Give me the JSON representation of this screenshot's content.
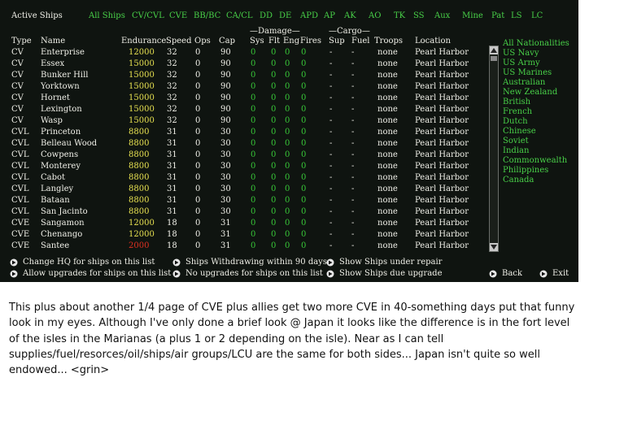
{
  "title": "Active Ships",
  "tabs": [
    "All Ships",
    "CV/CVL",
    "CVE",
    "BB/BC",
    "CA/CL",
    "DD",
    "DE",
    "APD",
    "AP",
    "AK",
    "AO",
    "TK",
    "SS",
    "Aux",
    "Mine",
    "Pat",
    "LS",
    "LC"
  ],
  "group_headers": {
    "damage": "Damage",
    "cargo": "Cargo"
  },
  "columns": [
    "Type",
    "Name",
    "Endurance",
    "Speed",
    "Ops",
    "Cap",
    "Sys",
    "Flt",
    "Eng",
    "Fires",
    "Sup",
    "Fuel",
    "Troops",
    "Location"
  ],
  "rows": [
    {
      "type": "CV",
      "name": "Enterprise",
      "endurance": "12000",
      "end_color": "yellow",
      "speed": "32",
      "ops": "0",
      "cap": "90",
      "sys": "0",
      "flt": "0",
      "eng": "0",
      "fires": "0",
      "sup": "-",
      "fuel": "-",
      "troops": "none",
      "location": "Pearl Harbor"
    },
    {
      "type": "CV",
      "name": "Essex",
      "endurance": "15000",
      "end_color": "yellow",
      "speed": "32",
      "ops": "0",
      "cap": "90",
      "sys": "0",
      "flt": "0",
      "eng": "0",
      "fires": "0",
      "sup": "-",
      "fuel": "-",
      "troops": "none",
      "location": "Pearl Harbor"
    },
    {
      "type": "CV",
      "name": "Bunker Hill",
      "endurance": "15000",
      "end_color": "yellow",
      "speed": "32",
      "ops": "0",
      "cap": "90",
      "sys": "0",
      "flt": "0",
      "eng": "0",
      "fires": "0",
      "sup": "-",
      "fuel": "-",
      "troops": "none",
      "location": "Pearl Harbor"
    },
    {
      "type": "CV",
      "name": "Yorktown",
      "endurance": "15000",
      "end_color": "yellow",
      "speed": "32",
      "ops": "0",
      "cap": "90",
      "sys": "0",
      "flt": "0",
      "eng": "0",
      "fires": "0",
      "sup": "-",
      "fuel": "-",
      "troops": "none",
      "location": "Pearl Harbor"
    },
    {
      "type": "CV",
      "name": "Hornet",
      "endurance": "15000",
      "end_color": "yellow",
      "speed": "32",
      "ops": "0",
      "cap": "90",
      "sys": "0",
      "flt": "0",
      "eng": "0",
      "fires": "0",
      "sup": "-",
      "fuel": "-",
      "troops": "none",
      "location": "Pearl Harbor"
    },
    {
      "type": "CV",
      "name": "Lexington",
      "endurance": "15000",
      "end_color": "yellow",
      "speed": "32",
      "ops": "0",
      "cap": "90",
      "sys": "0",
      "flt": "0",
      "eng": "0",
      "fires": "0",
      "sup": "-",
      "fuel": "-",
      "troops": "none",
      "location": "Pearl Harbor"
    },
    {
      "type": "CV",
      "name": "Wasp",
      "endurance": "15000",
      "end_color": "yellow",
      "speed": "32",
      "ops": "0",
      "cap": "90",
      "sys": "0",
      "flt": "0",
      "eng": "0",
      "fires": "0",
      "sup": "-",
      "fuel": "-",
      "troops": "none",
      "location": "Pearl Harbor"
    },
    {
      "type": "CVL",
      "name": "Princeton",
      "endurance": "8800",
      "end_color": "yellow",
      "speed": "31",
      "ops": "0",
      "cap": "30",
      "sys": "0",
      "flt": "0",
      "eng": "0",
      "fires": "0",
      "sup": "-",
      "fuel": "-",
      "troops": "none",
      "location": "Pearl Harbor"
    },
    {
      "type": "CVL",
      "name": "Belleau Wood",
      "endurance": "8800",
      "end_color": "yellow",
      "speed": "31",
      "ops": "0",
      "cap": "30",
      "sys": "0",
      "flt": "0",
      "eng": "0",
      "fires": "0",
      "sup": "-",
      "fuel": "-",
      "troops": "none",
      "location": "Pearl Harbor"
    },
    {
      "type": "CVL",
      "name": "Cowpens",
      "endurance": "8800",
      "end_color": "yellow",
      "speed": "31",
      "ops": "0",
      "cap": "30",
      "sys": "0",
      "flt": "0",
      "eng": "0",
      "fires": "0",
      "sup": "-",
      "fuel": "-",
      "troops": "none",
      "location": "Pearl Harbor"
    },
    {
      "type": "CVL",
      "name": "Monterey",
      "endurance": "8800",
      "end_color": "yellow",
      "speed": "31",
      "ops": "0",
      "cap": "30",
      "sys": "0",
      "flt": "0",
      "eng": "0",
      "fires": "0",
      "sup": "-",
      "fuel": "-",
      "troops": "none",
      "location": "Pearl Harbor"
    },
    {
      "type": "CVL",
      "name": "Cabot",
      "endurance": "8800",
      "end_color": "yellow",
      "speed": "31",
      "ops": "0",
      "cap": "30",
      "sys": "0",
      "flt": "0",
      "eng": "0",
      "fires": "0",
      "sup": "-",
      "fuel": "-",
      "troops": "none",
      "location": "Pearl Harbor"
    },
    {
      "type": "CVL",
      "name": "Langley",
      "endurance": "8800",
      "end_color": "yellow",
      "speed": "31",
      "ops": "0",
      "cap": "30",
      "sys": "0",
      "flt": "0",
      "eng": "0",
      "fires": "0",
      "sup": "-",
      "fuel": "-",
      "troops": "none",
      "location": "Pearl Harbor"
    },
    {
      "type": "CVL",
      "name": "Bataan",
      "endurance": "8800",
      "end_color": "yellow",
      "speed": "31",
      "ops": "0",
      "cap": "30",
      "sys": "0",
      "flt": "0",
      "eng": "0",
      "fires": "0",
      "sup": "-",
      "fuel": "-",
      "troops": "none",
      "location": "Pearl Harbor"
    },
    {
      "type": "CVL",
      "name": "San Jacinto",
      "endurance": "8800",
      "end_color": "yellow",
      "speed": "31",
      "ops": "0",
      "cap": "30",
      "sys": "0",
      "flt": "0",
      "eng": "0",
      "fires": "0",
      "sup": "-",
      "fuel": "-",
      "troops": "none",
      "location": "Pearl Harbor"
    },
    {
      "type": "CVE",
      "name": "Sangamon",
      "endurance": "12000",
      "end_color": "yellow",
      "speed": "18",
      "ops": "0",
      "cap": "31",
      "sys": "0",
      "flt": "0",
      "eng": "0",
      "fires": "0",
      "sup": "-",
      "fuel": "-",
      "troops": "none",
      "location": "Pearl Harbor"
    },
    {
      "type": "CVE",
      "name": "Chenango",
      "endurance": "12000",
      "end_color": "yellow",
      "speed": "18",
      "ops": "0",
      "cap": "31",
      "sys": "0",
      "flt": "0",
      "eng": "0",
      "fires": "0",
      "sup": "-",
      "fuel": "-",
      "troops": "none",
      "location": "Pearl Harbor"
    },
    {
      "type": "CVE",
      "name": "Santee",
      "endurance": "2000",
      "end_color": "red",
      "speed": "18",
      "ops": "0",
      "cap": "31",
      "sys": "0",
      "flt": "0",
      "eng": "0",
      "fires": "0",
      "sup": "-",
      "fuel": "-",
      "troops": "none",
      "location": "Pearl Harbor"
    }
  ],
  "nationalities": [
    "All Nationalities",
    "US Navy",
    "US Army",
    "US Marines",
    "Australian",
    "New Zealand",
    "British",
    "French",
    "Dutch",
    "Chinese",
    "Soviet",
    "Indian",
    "Commonwealth",
    "Philippines",
    "Canada"
  ],
  "options": {
    "change_hq": "Change HQ for ships on this list",
    "allow_upgrades": "Allow upgrades for ships on this list",
    "withdrawing": "Ships Withdrawing within 90 days",
    "no_upgrades": "No upgrades for ships on this list",
    "under_repair": "Show Ships under repair",
    "due_upgrade": "Show Ships due upgrade",
    "back": "Back",
    "exit": "Exit"
  },
  "colors": {
    "green": "#38c838",
    "yellow": "#e6e050",
    "red": "#e03020",
    "white": "#f0f0e8",
    "background": "#0f1410"
  },
  "caption": [
    "This plus about another 1/4 page of CVE plus allies get two more CVE in 40-something days put that funny",
    "look in my eyes.  Although I've only done a brief look @ Japan it looks like the difference is in the fort level",
    "of the isles in the Marianas (a plus 1 or 2 depending on the isle).  Near as I can tell",
    "supplies/fuel/resorces/oil/ships/air groups/LCU are the same for both sides... Japan isn't quite so well",
    "endowed... <grin>"
  ]
}
